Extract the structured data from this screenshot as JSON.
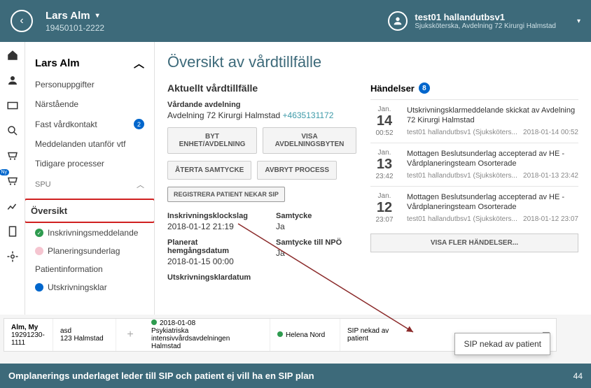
{
  "header": {
    "patient_name": "Lars Alm",
    "patient_id": "19450101-2222",
    "user_name": "test01 hallandutbsv1",
    "user_role": "Sjuksköterska, Avdelning 72 Kirurgi Halmstad"
  },
  "sidebar": {
    "section_title": "Lars Alm",
    "items": [
      {
        "label": "Personuppgifter"
      },
      {
        "label": "Närstående"
      },
      {
        "label": "Fast vårdkontakt",
        "count": "2"
      },
      {
        "label": "Meddelanden utanför vtf"
      },
      {
        "label": "Tidigare processer"
      }
    ],
    "spu_label": "SPU",
    "oversikt": "Översikt",
    "statuses": [
      {
        "label": "Inskrivningsmeddelande",
        "dot": "green"
      },
      {
        "label": "Planeringsunderlag",
        "dot": "pink"
      },
      {
        "label": "Patientinformation",
        "dot": ""
      },
      {
        "label": "Utskrivningsklar",
        "dot": "blue"
      }
    ]
  },
  "content": {
    "title": "Översikt av vårdtillfälle",
    "aktuellt": "Aktuellt vårdtillfälle",
    "vardande_label": "Vårdande avdelning",
    "vardande_val": "Avdelning 72 Kirurgi Halmstad ",
    "vardande_phone": "+4635131172",
    "buttons": {
      "byt": "BYT ENHET/AVDELNING",
      "visa_byten": "VISA AVDELNINGSBYTEN",
      "aterta": "ÅTERTA SAMTYCKE",
      "avbryt": "AVBRYT PROCESS",
      "registrera": "REGISTRERA PATIENT NEKAR SIP"
    },
    "fields": {
      "inskrivning_lbl": "Inskrivningsklockslag",
      "inskrivning_val": "2018-01-12 21:19",
      "samtycke_lbl": "Samtycke",
      "samtycke_val": "Ja",
      "planerat_lbl": "Planerat hemgångsdatum",
      "planerat_val": "2018-01-15 00:00",
      "samtycke_npo_lbl": "Samtycke till NPÖ",
      "samtycke_npo_val": "Ja",
      "utskriv_lbl": "Utskrivningsklardatum"
    },
    "events_label": "Händelser",
    "events_count": "8",
    "events": [
      {
        "mon": "Jan.",
        "day": "14",
        "time": "00:52",
        "title": "Utskrivningsklarmeddelande skickat av Avdelning 72 Kirurgi Halmstad",
        "meta_user": "test01 hallandutbsv1 (Sjuksköters...",
        "meta_time": "2018-01-14 00:52"
      },
      {
        "mon": "Jan.",
        "day": "13",
        "time": "23:42",
        "title": "Mottagen Beslutsunderlag accepterad av HE - Vårdplaneringsteam Osorterade",
        "meta_user": "test01 hallandutbsv1 (Sjuksköters...",
        "meta_time": "2018-01-13 23:42"
      },
      {
        "mon": "Jan.",
        "day": "12",
        "time": "23:07",
        "title": "Mottagen Beslutsunderlag accepterad av HE - Vårdplaneringsteam Osorterade",
        "meta_user": "test01 hallandutbsv1 (Sjuksköters...",
        "meta_time": "2018-01-12 23:07"
      }
    ],
    "more_events": "VISA FLER HÄNDELSER..."
  },
  "bottom": {
    "name": "Alm, My",
    "id": "19291230-1111",
    "ward": "asd",
    "ward2": "123 Halmstad",
    "date": "2018-01-08",
    "unit1": "Psykiatriska",
    "unit2": "intensivvårdsavdelningen",
    "unit3": "Halmstad",
    "person": "Helena Nord",
    "sip1": "SIP nekad av",
    "sip2": "patient",
    "callout": "SIP nekad av patient"
  },
  "footer": {
    "text": "Omplanerings underlaget leder till SIP och patient ej vill ha en SIP plan",
    "page": "44"
  }
}
